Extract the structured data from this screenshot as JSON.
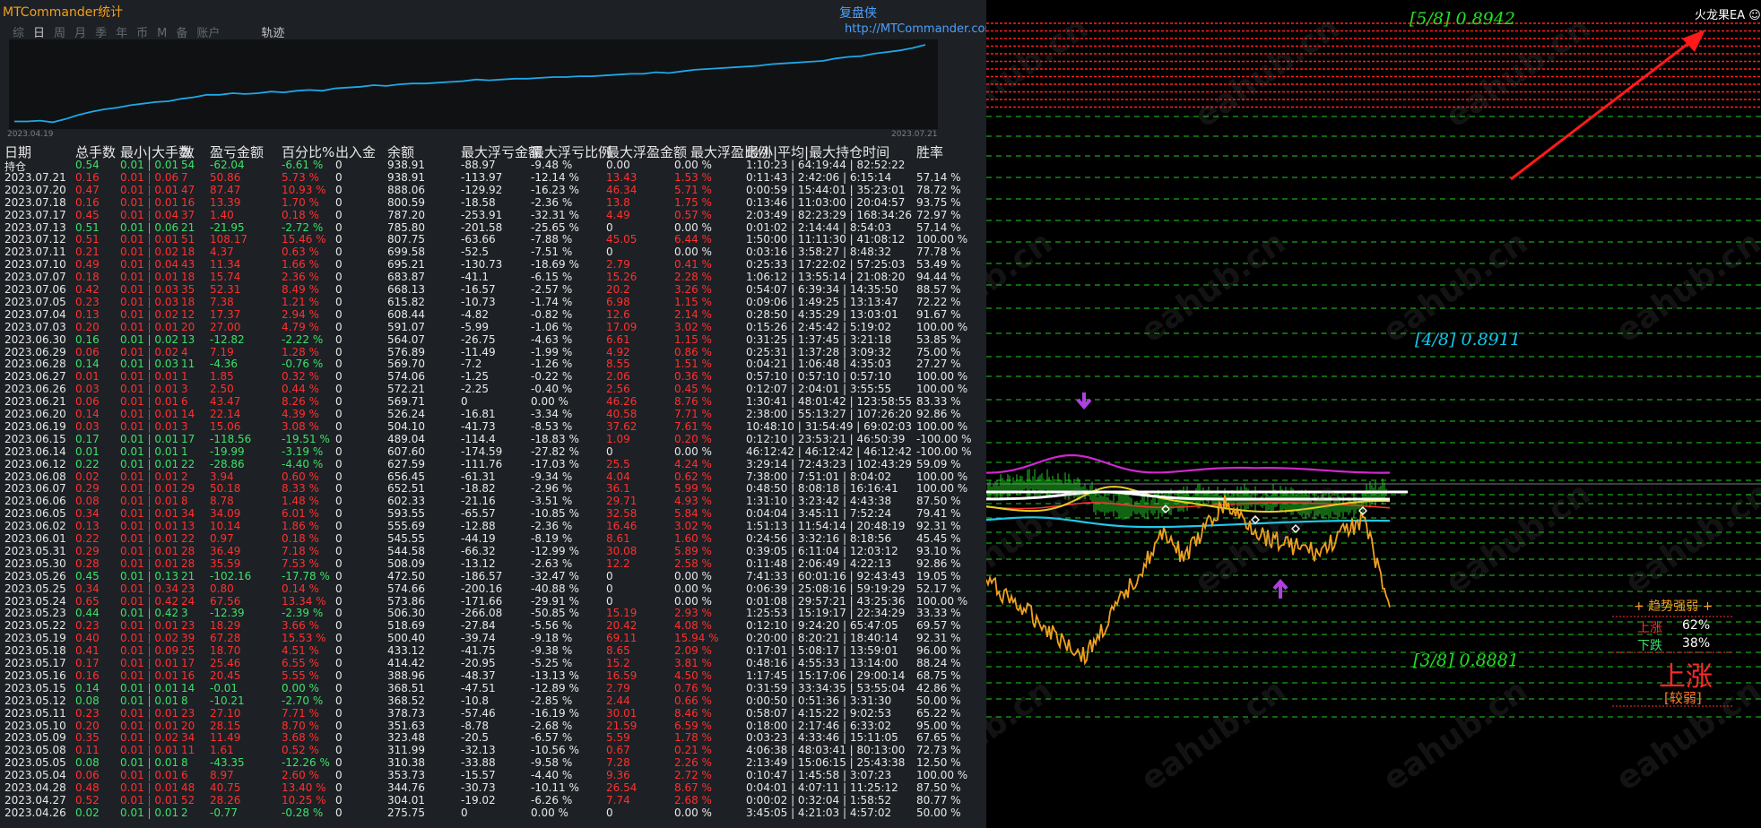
{
  "app": {
    "title": "MTCommander统计",
    "brand_cn": "复盘侠",
    "brand_url": "http://MTCommander.com"
  },
  "tabs": [
    "综",
    "日",
    "周",
    "月",
    "季",
    "年",
    "币",
    "M",
    "备",
    "账户"
  ],
  "tab_selected": "日",
  "tab_last": "轨迹",
  "equity_chart": {
    "start_date": "2023.04.19",
    "end_date": "2023.07.21",
    "line_color": "#1ea8e8",
    "y": [
      0.05,
      0.05,
      0.06,
      0.04,
      0.08,
      0.13,
      0.17,
      0.2,
      0.22,
      0.25,
      0.27,
      0.29,
      0.3,
      0.33,
      0.35,
      0.38,
      0.38,
      0.4,
      0.39,
      0.4,
      0.42,
      0.41,
      0.43,
      0.44,
      0.43,
      0.46,
      0.47,
      0.48,
      0.5,
      0.49,
      0.51,
      0.52,
      0.52,
      0.53,
      0.54,
      0.55,
      0.57,
      0.56,
      0.57,
      0.58,
      0.58,
      0.59,
      0.6,
      0.6,
      0.61,
      0.61,
      0.62,
      0.63,
      0.64,
      0.64,
      0.66,
      0.65,
      0.67,
      0.69,
      0.7,
      0.71,
      0.72,
      0.73,
      0.74,
      0.76,
      0.77,
      0.78,
      0.79,
      0.8,
      0.83,
      0.85,
      0.86,
      0.89,
      0.91,
      0.93,
      0.96,
      1.0
    ]
  },
  "table": {
    "headers": [
      "日期",
      "总手数",
      "最小|大手数",
      "数",
      "盈亏金额",
      "百分比%",
      "出入金",
      "余额",
      "最大浮亏金额",
      "最大浮亏比例",
      "最大浮盈金额",
      "最大浮盈比例",
      "最小|平均|最大持仓时间",
      "胜率"
    ],
    "rows": [
      [
        "持仓",
        "0.54",
        "0.01 | 0.01",
        "54",
        "-62.04",
        "-6.61 %",
        "0",
        "938.91",
        "-88.97",
        "-9.48 %",
        "0.00",
        "0.00 %",
        "1:10:23 | 64:19:44 | 82:52:22",
        ""
      ],
      [
        "2023.07.21",
        "0.16",
        "0.01 | 0.06",
        "7",
        "50.86",
        "5.73 %",
        "0",
        "938.91",
        "-113.97",
        "-12.14 %",
        "13.43",
        "1.53 %",
        "0:11:43 | 2:42:06 | 6:15:14",
        "57.14 %"
      ],
      [
        "2023.07.20",
        "0.47",
        "0.01 | 0.01",
        "47",
        "87.47",
        "10.93 %",
        "0",
        "888.06",
        "-129.92",
        "-16.23 %",
        "46.34",
        "5.71 %",
        "0:00:59 | 15:44:01 | 35:23:01",
        "78.72 %"
      ],
      [
        "2023.07.18",
        "0.16",
        "0.01 | 0.01",
        "16",
        "13.39",
        "1.70 %",
        "0",
        "800.59",
        "-18.58",
        "-2.36 %",
        "13.8",
        "1.75 %",
        "0:13:46 | 11:03:00 | 20:04:57",
        "93.75 %"
      ],
      [
        "2023.07.17",
        "0.45",
        "0.01 | 0.04",
        "37",
        "1.40",
        "0.18 %",
        "0",
        "787.20",
        "-253.91",
        "-32.31 %",
        "4.49",
        "0.57 %",
        "2:03:49 | 82:23:29 | 168:34:26",
        "72.97 %"
      ],
      [
        "2023.07.13",
        "0.51",
        "0.01 | 0.06",
        "21",
        "-21.95",
        "-2.72 %",
        "0",
        "785.80",
        "-201.58",
        "-25.65 %",
        "0",
        "0.00 %",
        "0:01:02 | 2:14:44 | 8:54:03",
        "57.14 %"
      ],
      [
        "2023.07.12",
        "0.51",
        "0.01 | 0.01",
        "51",
        "108.17",
        "15.46 %",
        "0",
        "807.75",
        "-63.66",
        "-7.88 %",
        "45.05",
        "6.44 %",
        "1:50:00 | 11:11:30 | 41:08:12",
        "100.00 %"
      ],
      [
        "2023.07.11",
        "0.21",
        "0.01 | 0.02",
        "18",
        "4.37",
        "0.63 %",
        "0",
        "699.58",
        "-52.5",
        "-7.51 %",
        "0",
        "0.00 %",
        "0:03:16 | 3:58:27 | 8:48:32",
        "77.78 %"
      ],
      [
        "2023.07.10",
        "0.49",
        "0.01 | 0.04",
        "43",
        "11.34",
        "1.66 %",
        "0",
        "695.21",
        "-130.73",
        "-18.69 %",
        "2.79",
        "0.41 %",
        "0:25:33 | 17:22:02 | 57:25:03",
        "53.49 %"
      ],
      [
        "2023.07.07",
        "0.18",
        "0.01 | 0.01",
        "18",
        "15.74",
        "2.36 %",
        "0",
        "683.87",
        "-41.1",
        "-6.15 %",
        "15.26",
        "2.28 %",
        "1:06:12 | 13:55:14 | 21:08:20",
        "94.44 %"
      ],
      [
        "2023.07.06",
        "0.42",
        "0.01 | 0.03",
        "35",
        "52.31",
        "8.49 %",
        "0",
        "668.13",
        "-16.57",
        "-2.57 %",
        "20.2",
        "3.26 %",
        "0:54:07 | 6:39:34 | 14:35:50",
        "88.57 %"
      ],
      [
        "2023.07.05",
        "0.23",
        "0.01 | 0.03",
        "18",
        "7.38",
        "1.21 %",
        "0",
        "615.82",
        "-10.73",
        "-1.74 %",
        "6.98",
        "1.15 %",
        "0:09:06 | 1:49:25 | 13:13:47",
        "72.22 %"
      ],
      [
        "2023.07.04",
        "0.13",
        "0.01 | 0.02",
        "12",
        "17.37",
        "2.94 %",
        "0",
        "608.44",
        "-4.82",
        "-0.82 %",
        "12.6",
        "2.14 %",
        "0:28:50 | 4:35:29 | 13:03:01",
        "91.67 %"
      ],
      [
        "2023.07.03",
        "0.20",
        "0.01 | 0.01",
        "20",
        "27.00",
        "4.79 %",
        "0",
        "591.07",
        "-5.99",
        "-1.06 %",
        "17.09",
        "3.02 %",
        "0:15:26 | 2:45:42 | 5:19:02",
        "100.00 %"
      ],
      [
        "2023.06.30",
        "0.16",
        "0.01 | 0.02",
        "13",
        "-12.82",
        "-2.22 %",
        "0",
        "564.07",
        "-26.75",
        "-4.63 %",
        "6.61",
        "1.15 %",
        "0:31:25 | 1:37:45 | 3:21:18",
        "53.85 %"
      ],
      [
        "2023.06.29",
        "0.06",
        "0.01 | 0.02",
        "4",
        "7.19",
        "1.28 %",
        "0",
        "576.89",
        "-11.49",
        "-1.99 %",
        "4.92",
        "0.86 %",
        "0:25:31 | 1:37:28 | 3:09:32",
        "75.00 %"
      ],
      [
        "2023.06.28",
        "0.14",
        "0.01 | 0.03",
        "11",
        "-4.36",
        "-0.76 %",
        "0",
        "569.70",
        "-7.2",
        "-1.26 %",
        "8.55",
        "1.51 %",
        "0:04:21 | 1:06:48 | 4:35:03",
        "27.27 %"
      ],
      [
        "2023.06.27",
        "0.01",
        "0.01 | 0.01",
        "1",
        "1.85",
        "0.32 %",
        "0",
        "574.06",
        "-1.25",
        "-0.22 %",
        "2.06",
        "0.36 %",
        "0:57:10 | 0:57:10 | 0:57:10",
        "100.00 %"
      ],
      [
        "2023.06.26",
        "0.03",
        "0.01 | 0.01",
        "3",
        "2.50",
        "0.44 %",
        "0",
        "572.21",
        "-2.25",
        "-0.40 %",
        "2.56",
        "0.45 %",
        "0:12:07 | 2:04:01 | 3:55:55",
        "100.00 %"
      ],
      [
        "2023.06.21",
        "0.06",
        "0.01 | 0.01",
        "6",
        "43.47",
        "8.26 %",
        "0",
        "569.71",
        "0",
        "0.00 %",
        "46.26",
        "8.76 %",
        "1:30:41 | 48:01:42 | 123:58:55",
        "83.33 %"
      ],
      [
        "2023.06.20",
        "0.14",
        "0.01 | 0.01",
        "14",
        "22.14",
        "4.39 %",
        "0",
        "526.24",
        "-16.81",
        "-3.34 %",
        "40.58",
        "7.71 %",
        "2:38:00 | 55:13:27 | 107:26:20",
        "92.86 %"
      ],
      [
        "2023.06.19",
        "0.03",
        "0.01 | 0.01",
        "3",
        "15.06",
        "3.08 %",
        "0",
        "504.10",
        "-41.73",
        "-8.53 %",
        "37.62",
        "7.61 %",
        "10:48:10 | 31:54:49 | 69:02:03",
        "100.00 %"
      ],
      [
        "2023.06.15",
        "0.17",
        "0.01 | 0.01",
        "17",
        "-118.56",
        "-19.51 %",
        "0",
        "489.04",
        "-114.4",
        "-18.83 %",
        "1.09",
        "0.20 %",
        "0:12:10 | 23:53:21 | 46:50:39",
        "-100.00 %"
      ],
      [
        "2023.06.14",
        "0.01",
        "0.01 | 0.01",
        "1",
        "-19.99",
        "-3.19 %",
        "0",
        "607.60",
        "-174.59",
        "-27.82 %",
        "0",
        "0.00 %",
        "46:12:42 | 46:12:42 | 46:12:42",
        "-100.00 %"
      ],
      [
        "2023.06.12",
        "0.22",
        "0.01 | 0.01",
        "22",
        "-28.86",
        "-4.40 %",
        "0",
        "627.59",
        "-111.76",
        "-17.03 %",
        "25.5",
        "4.24 %",
        "3:29:14 | 72:43:23 | 102:43:29",
        "59.09 %"
      ],
      [
        "2023.06.08",
        "0.02",
        "0.01 | 0.01",
        "2",
        "3.94",
        "0.60 %",
        "0",
        "656.45",
        "-61.31",
        "-9.34 %",
        "4.04",
        "0.62 %",
        "7:38:00 | 7:51:01 | 8:04:02",
        "100.00 %"
      ],
      [
        "2023.06.07",
        "0.29",
        "0.01 | 0.01",
        "29",
        "50.18",
        "8.33 %",
        "0",
        "652.51",
        "-18.82",
        "-2.96 %",
        "36.1",
        "5.99 %",
        "0:48:50 | 8:08:18 | 16:16:41",
        "100.00 %"
      ],
      [
        "2023.06.06",
        "0.08",
        "0.01 | 0.01",
        "8",
        "8.78",
        "1.48 %",
        "0",
        "602.33",
        "-21.16",
        "-3.51 %",
        "29.71",
        "4.93 %",
        "1:31:10 | 3:23:42 | 4:43:38",
        "87.50 %"
      ],
      [
        "2023.06.05",
        "0.34",
        "0.01 | 0.01",
        "34",
        "34.09",
        "6.01 %",
        "0",
        "593.55",
        "-65.57",
        "-10.85 %",
        "32.58",
        "5.84 %",
        "0:04:04 | 3:45:11 | 7:52:24",
        "79.41 %"
      ],
      [
        "2023.06.02",
        "0.13",
        "0.01 | 0.01",
        "13",
        "10.14",
        "1.86 %",
        "0",
        "555.69",
        "-12.88",
        "-2.36 %",
        "16.46",
        "3.02 %",
        "1:51:13 | 11:54:14 | 20:48:19",
        "92.31 %"
      ],
      [
        "2023.06.01",
        "0.22",
        "0.01 | 0.01",
        "22",
        "0.97",
        "0.18 %",
        "0",
        "545.55",
        "-44.19",
        "-8.19 %",
        "8.61",
        "1.60 %",
        "0:24:56 | 3:32:16 | 8:18:56",
        "45.45 %"
      ],
      [
        "2023.05.31",
        "0.29",
        "0.01 | 0.01",
        "28",
        "36.49",
        "7.18 %",
        "0",
        "544.58",
        "-66.32",
        "-12.99 %",
        "30.08",
        "5.89 %",
        "0:39:05 | 6:11:04 | 12:03:12",
        "93.10 %"
      ],
      [
        "2023.05.30",
        "0.28",
        "0.01 | 0.01",
        "28",
        "35.59",
        "7.53 %",
        "0",
        "508.09",
        "-13.12",
        "-2.63 %",
        "12.2",
        "2.58 %",
        "0:11:48 | 2:06:49 | 4:22:13",
        "92.86 %"
      ],
      [
        "2023.05.26",
        "0.45",
        "0.01 | 0.13",
        "21",
        "-102.16",
        "-17.78 %",
        "0",
        "472.50",
        "-186.57",
        "-32.47 %",
        "0",
        "0.00 %",
        "7:41:33 | 60:01:16 | 92:43:43",
        "19.05 %"
      ],
      [
        "2023.05.25",
        "0.34",
        "0.01 | 0.34",
        "23",
        "0.80",
        "0.14 %",
        "0",
        "574.66",
        "-200.16",
        "-40.88 %",
        "0",
        "0.00 %",
        "0:06:39 | 25:08:16 | 59:19:29",
        "52.17 %"
      ],
      [
        "2023.05.24",
        "0.65",
        "0.01 | 0.42",
        "24",
        "67.56",
        "13.34 %",
        "0",
        "573.86",
        "-171.66",
        "-29.91 %",
        "0",
        "0.00 %",
        "0:01:08 | 29:57:21 | 43:25:36",
        "100.00 %"
      ],
      [
        "2023.05.23",
        "0.44",
        "0.01 | 0.42",
        "3",
        "-12.39",
        "-2.39 %",
        "0",
        "506.30",
        "-266.08",
        "-50.85 %",
        "15.19",
        "2.93 %",
        "1:25:53 | 15:19:17 | 22:34:29",
        "33.33 %"
      ],
      [
        "2023.05.22",
        "0.23",
        "0.01 | 0.01",
        "23",
        "18.29",
        "3.66 %",
        "0",
        "518.69",
        "-27.84",
        "-5.56 %",
        "20.42",
        "4.08 %",
        "0:12:10 | 9:24:20 | 65:47:05",
        "69.57 %"
      ],
      [
        "2023.05.19",
        "0.40",
        "0.01 | 0.02",
        "39",
        "67.28",
        "15.53 %",
        "0",
        "500.40",
        "-39.74",
        "-9.18 %",
        "69.11",
        "15.94 %",
        "0:20:00 | 8:20:21 | 18:40:14",
        "92.31 %"
      ],
      [
        "2023.05.18",
        "0.41",
        "0.01 | 0.09",
        "25",
        "18.70",
        "4.51 %",
        "0",
        "433.12",
        "-41.75",
        "-9.38 %",
        "8.65",
        "2.09 %",
        "0:17:01 | 5:08:17 | 13:59:01",
        "96.00 %"
      ],
      [
        "2023.05.17",
        "0.17",
        "0.01 | 0.01",
        "17",
        "25.46",
        "6.55 %",
        "0",
        "414.42",
        "-20.95",
        "-5.25 %",
        "15.2",
        "3.81 %",
        "0:48:16 | 4:55:33 | 13:14:00",
        "88.24 %"
      ],
      [
        "2023.05.16",
        "0.16",
        "0.01 | 0.01",
        "16",
        "20.45",
        "5.55 %",
        "0",
        "388.96",
        "-48.37",
        "-13.13 %",
        "16.59",
        "4.50 %",
        "1:17:45 | 15:17:06 | 29:00:14",
        "68.75 %"
      ],
      [
        "2023.05.15",
        "0.14",
        "0.01 | 0.01",
        "14",
        "-0.01",
        "0.00 %",
        "0",
        "368.51",
        "-47.51",
        "-12.89 %",
        "2.79",
        "0.76 %",
        "0:31:59 | 33:34:35 | 53:55:04",
        "42.86 %"
      ],
      [
        "2023.05.12",
        "0.08",
        "0.01 | 0.01",
        "8",
        "-10.21",
        "-2.70 %",
        "0",
        "368.52",
        "-10.8",
        "-2.85 %",
        "2.44",
        "0.66 %",
        "0:00:50 | 0:51:36 | 3:31:30",
        "50.00 %"
      ],
      [
        "2023.05.11",
        "0.23",
        "0.01 | 0.01",
        "23",
        "27.10",
        "7.71 %",
        "0",
        "378.73",
        "-57.46",
        "-16.19 %",
        "30.01",
        "8.46 %",
        "0:58:07 | 4:15:22 | 9:02:53",
        "65.22 %"
      ],
      [
        "2023.05.10",
        "0.20",
        "0.01 | 0.01",
        "20",
        "28.15",
        "8.70 %",
        "0",
        "351.63",
        "-8.78",
        "-2.68 %",
        "21.59",
        "6.59 %",
        "0:18:00 | 2:17:46 | 6:33:02",
        "95.00 %"
      ],
      [
        "2023.05.09",
        "0.35",
        "0.01 | 0.02",
        "34",
        "11.49",
        "3.68 %",
        "0",
        "323.48",
        "-20.5",
        "-6.57 %",
        "5.59",
        "1.78 %",
        "0:03:23 | 4:33:46 | 15:11:05",
        "67.65 %"
      ],
      [
        "2023.05.08",
        "0.11",
        "0.01 | 0.01",
        "11",
        "1.61",
        "0.52 %",
        "0",
        "311.99",
        "-32.13",
        "-10.56 %",
        "0.67",
        "0.21 %",
        "4:06:38 | 48:03:41 | 80:13:00",
        "72.73 %"
      ],
      [
        "2023.05.05",
        "0.08",
        "0.01 | 0.01",
        "8",
        "-43.35",
        "-12.26 %",
        "0",
        "310.38",
        "-33.88",
        "-9.58 %",
        "7.28",
        "2.26 %",
        "2:13:49 | 15:06:15 | 25:43:38",
        "12.50 %"
      ],
      [
        "2023.05.04",
        "0.06",
        "0.01 | 0.01",
        "6",
        "8.97",
        "2.60 %",
        "0",
        "353.73",
        "-15.57",
        "-4.40 %",
        "9.36",
        "2.72 %",
        "0:10:47 | 1:45:58 | 3:07:23",
        "100.00 %"
      ],
      [
        "2023.04.28",
        "0.48",
        "0.01 | 0.01",
        "48",
        "40.75",
        "13.40 %",
        "0",
        "344.76",
        "-30.73",
        "-10.11 %",
        "26.54",
        "8.67 %",
        "0:04:01 | 4:07:11 | 11:25:12",
        "87.50 %"
      ],
      [
        "2023.04.27",
        "0.52",
        "0.01 | 0.01",
        "52",
        "28.26",
        "10.25 %",
        "0",
        "304.01",
        "-19.02",
        "-6.26 %",
        "7.74",
        "2.68 %",
        "0:00:02 | 0:32:04 | 1:58:52",
        "80.77 %"
      ],
      [
        "2023.04.26",
        "0.02",
        "0.01 | 0.01",
        "2",
        "-0.77",
        "-0.28 %",
        "0",
        "275.75",
        "0",
        "0.00 %",
        "0",
        "0.00 %",
        "3:45:05 | 4:21:03 | 4:57:02",
        "50.00 %"
      ]
    ]
  },
  "chart": {
    "ea_label": "火龙果EA",
    "levels": [
      {
        "label": "[5/8]",
        "value": "0.8942",
        "color": "#22e022"
      },
      {
        "label": "[4/8]",
        "value": "0.8911",
        "color": "#10c8e8"
      },
      {
        "label": "[3/8]",
        "value": "0.8881",
        "color": "#22e022"
      }
    ],
    "trend_panel": {
      "title": "+ 趋势强弱 +",
      "up_label": "上涨",
      "up_value": "62%",
      "down_label": "下跌",
      "down_value": "38%",
      "main": "上涨",
      "strength": "[较弱]"
    },
    "watermark": "eahub.cn"
  }
}
